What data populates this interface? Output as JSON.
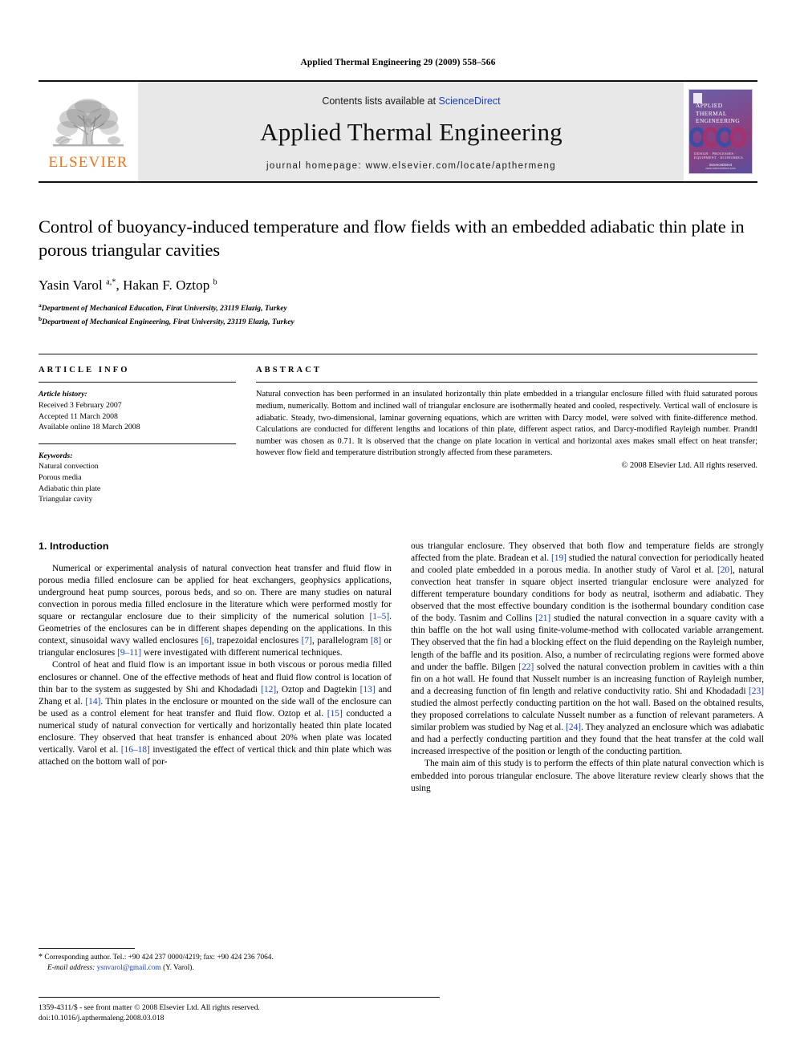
{
  "running_head": "Applied Thermal Engineering 29 (2009) 558–566",
  "masthead": {
    "publisher_name": "ELSEVIER",
    "contents_prefix": "Contents lists available at ",
    "contents_link": "ScienceDirect",
    "journal_name": "Applied Thermal Engineering",
    "homepage": "journal homepage: www.elsevier.com/locate/apthermeng",
    "cover": {
      "title_line1": "APPLIED",
      "title_line2": "THERMAL",
      "title_line3": "ENGINEERING",
      "footer_line": "DESIGN · PROCESSES · EQUIPMENT · ECONOMICS",
      "sciencedirect": "ScienceDirect",
      "sciencedirect_sub": "www.sciencedirect.com"
    }
  },
  "article": {
    "title": "Control of buoyancy-induced temperature and flow fields with an embedded adiabatic thin plate in porous triangular cavities",
    "authors_html": "Yasin Varol <sup>a,*</sup>, Hakan F. Oztop <sup>b</sup>",
    "affiliation_a": "Department of Mechanical Education, Firat University, 23119 Elazig, Turkey",
    "affiliation_b": "Department of Mechanical Engineering, Firat University, 23119 Elazig, Turkey"
  },
  "article_info": {
    "heading": "ARTICLE INFO",
    "history_label": "Article history:",
    "history": [
      "Received 3 February 2007",
      "Accepted 11 March 2008",
      "Available online 18 March 2008"
    ],
    "keywords_label": "Keywords:",
    "keywords": [
      "Natural convection",
      "Porous media",
      "Adiabatic thin plate",
      "Triangular cavity"
    ]
  },
  "abstract": {
    "heading": "ABSTRACT",
    "text": "Natural convection has been performed in an insulated horizontally thin plate embedded in a triangular enclosure filled with fluid saturated porous medium, numerically. Bottom and inclined wall of triangular enclosure are isothermally heated and cooled, respectively. Vertical wall of enclosure is adiabatic. Steady, two-dimensional, laminar governing equations, which are written with Darcy model, were solved with finite-difference method. Calculations are conducted for different lengths and locations of thin plate, different aspect ratios, and Darcy-modified Rayleigh number. Prandtl number was chosen as 0.71. It is observed that the change on plate location in vertical and horizontal axes makes small effect on heat transfer; however flow field and temperature distribution strongly affected from these parameters.",
    "copyright": "© 2008 Elsevier Ltd. All rights reserved."
  },
  "introduction": {
    "section_number": "1.",
    "section_title": "Introduction",
    "left_paragraphs": [
      "Numerical or experimental analysis of natural convection heat transfer and fluid flow in porous media filled enclosure can be applied for heat exchangers, geophysics applications, underground heat pump sources, porous beds, and so on. There are many studies on natural convection in porous media filled enclosure in the literature which were performed mostly for square or rectangular enclosure due to their simplicity of the numerical solution [1–5]. Geometries of the enclosures can be in different shapes depending on the applications. In this context, sinusoidal wavy walled enclosures [6], trapezoidal enclosures [7], parallelogram [8] or triangular enclosures [9–11] were investigated with different numerical techniques.",
      "Control of heat and fluid flow is an important issue in both viscous or porous media filled enclosures or channel. One of the effective methods of heat and fluid flow control is location of thin bar to the system as suggested by Shi and Khodadadi [12], Oztop and Dagtekin [13] and Zhang et al. [14]. Thin plates in the enclosure or mounted on the side wall of the enclosure can be used as a control element for heat transfer and fluid flow. Oztop et al. [15] conducted a numerical study of natural convection for vertically and horizontally heated thin plate located enclosure. They observed that heat transfer is enhanced about 20% when plate was located vertically. Varol et al. [16–18] investigated the effect of vertical thick and thin plate which was attached on the bottom wall of por-"
    ],
    "right_paragraphs": [
      "ous triangular enclosure. They observed that both flow and temperature fields are strongly affected from the plate. Bradean et al. [19] studied the natural convection for periodically heated and cooled plate embedded in a porous media. In another study of Varol et al. [20], natural convection heat transfer in square object inserted triangular enclosure were analyzed for different temperature boundary conditions for body as neutral, isotherm and adiabatic. They observed that the most effective boundary condition is the isothermal boundary condition case of the body. Tasnim and Collins [21] studied the natural convection in a square cavity with a thin baffle on the hot wall using finite-volume-method with collocated variable arrangement. They observed that the fin had a blocking effect on the fluid depending on the Rayleigh number, length of the baffle and its position. Also, a number of recirculating regions were formed above and under the baffle. Bilgen [22] solved the natural convection problem in cavities with a thin fin on a hot wall. He found that Nusselt number is an increasing function of Rayleigh number, and a decreasing function of fin length and relative conductivity ratio. Shi and Khodadadi [23] studied the almost perfectly conducting partition on the hot wall. Based on the obtained results, they proposed correlations to calculate Nusselt number as a function of relevant parameters. A similar problem was studied by Nag et al. [24]. They analyzed an enclosure which was adiabatic and had a perfectly conducting partition and they found that the heat transfer at the cold wall increased irrespective of the position or length of the conducting partition.",
      "The main aim of this study is to perform the effects of thin plate natural convection which is embedded into porous triangular enclosure. The above literature review clearly shows that the using"
    ]
  },
  "footnote": {
    "corresponding_text": "Corresponding author. Tel.: +90 424 237 0000/4219; fax: +90 424 236 7064.",
    "email_label": "E-mail address:",
    "email": "ysnvarol@gmail.com",
    "email_owner": "(Y. Varol)."
  },
  "footer": {
    "issn_line": "1359-4311/$ - see front matter © 2008 Elsevier Ltd. All rights reserved.",
    "doi_line": "doi:10.1016/j.apthermaleng.2008.03.018"
  },
  "colors": {
    "link_blue": "#1a3fbf",
    "elsevier_orange": "#E87722",
    "masthead_grey": "#e8e8e8"
  }
}
